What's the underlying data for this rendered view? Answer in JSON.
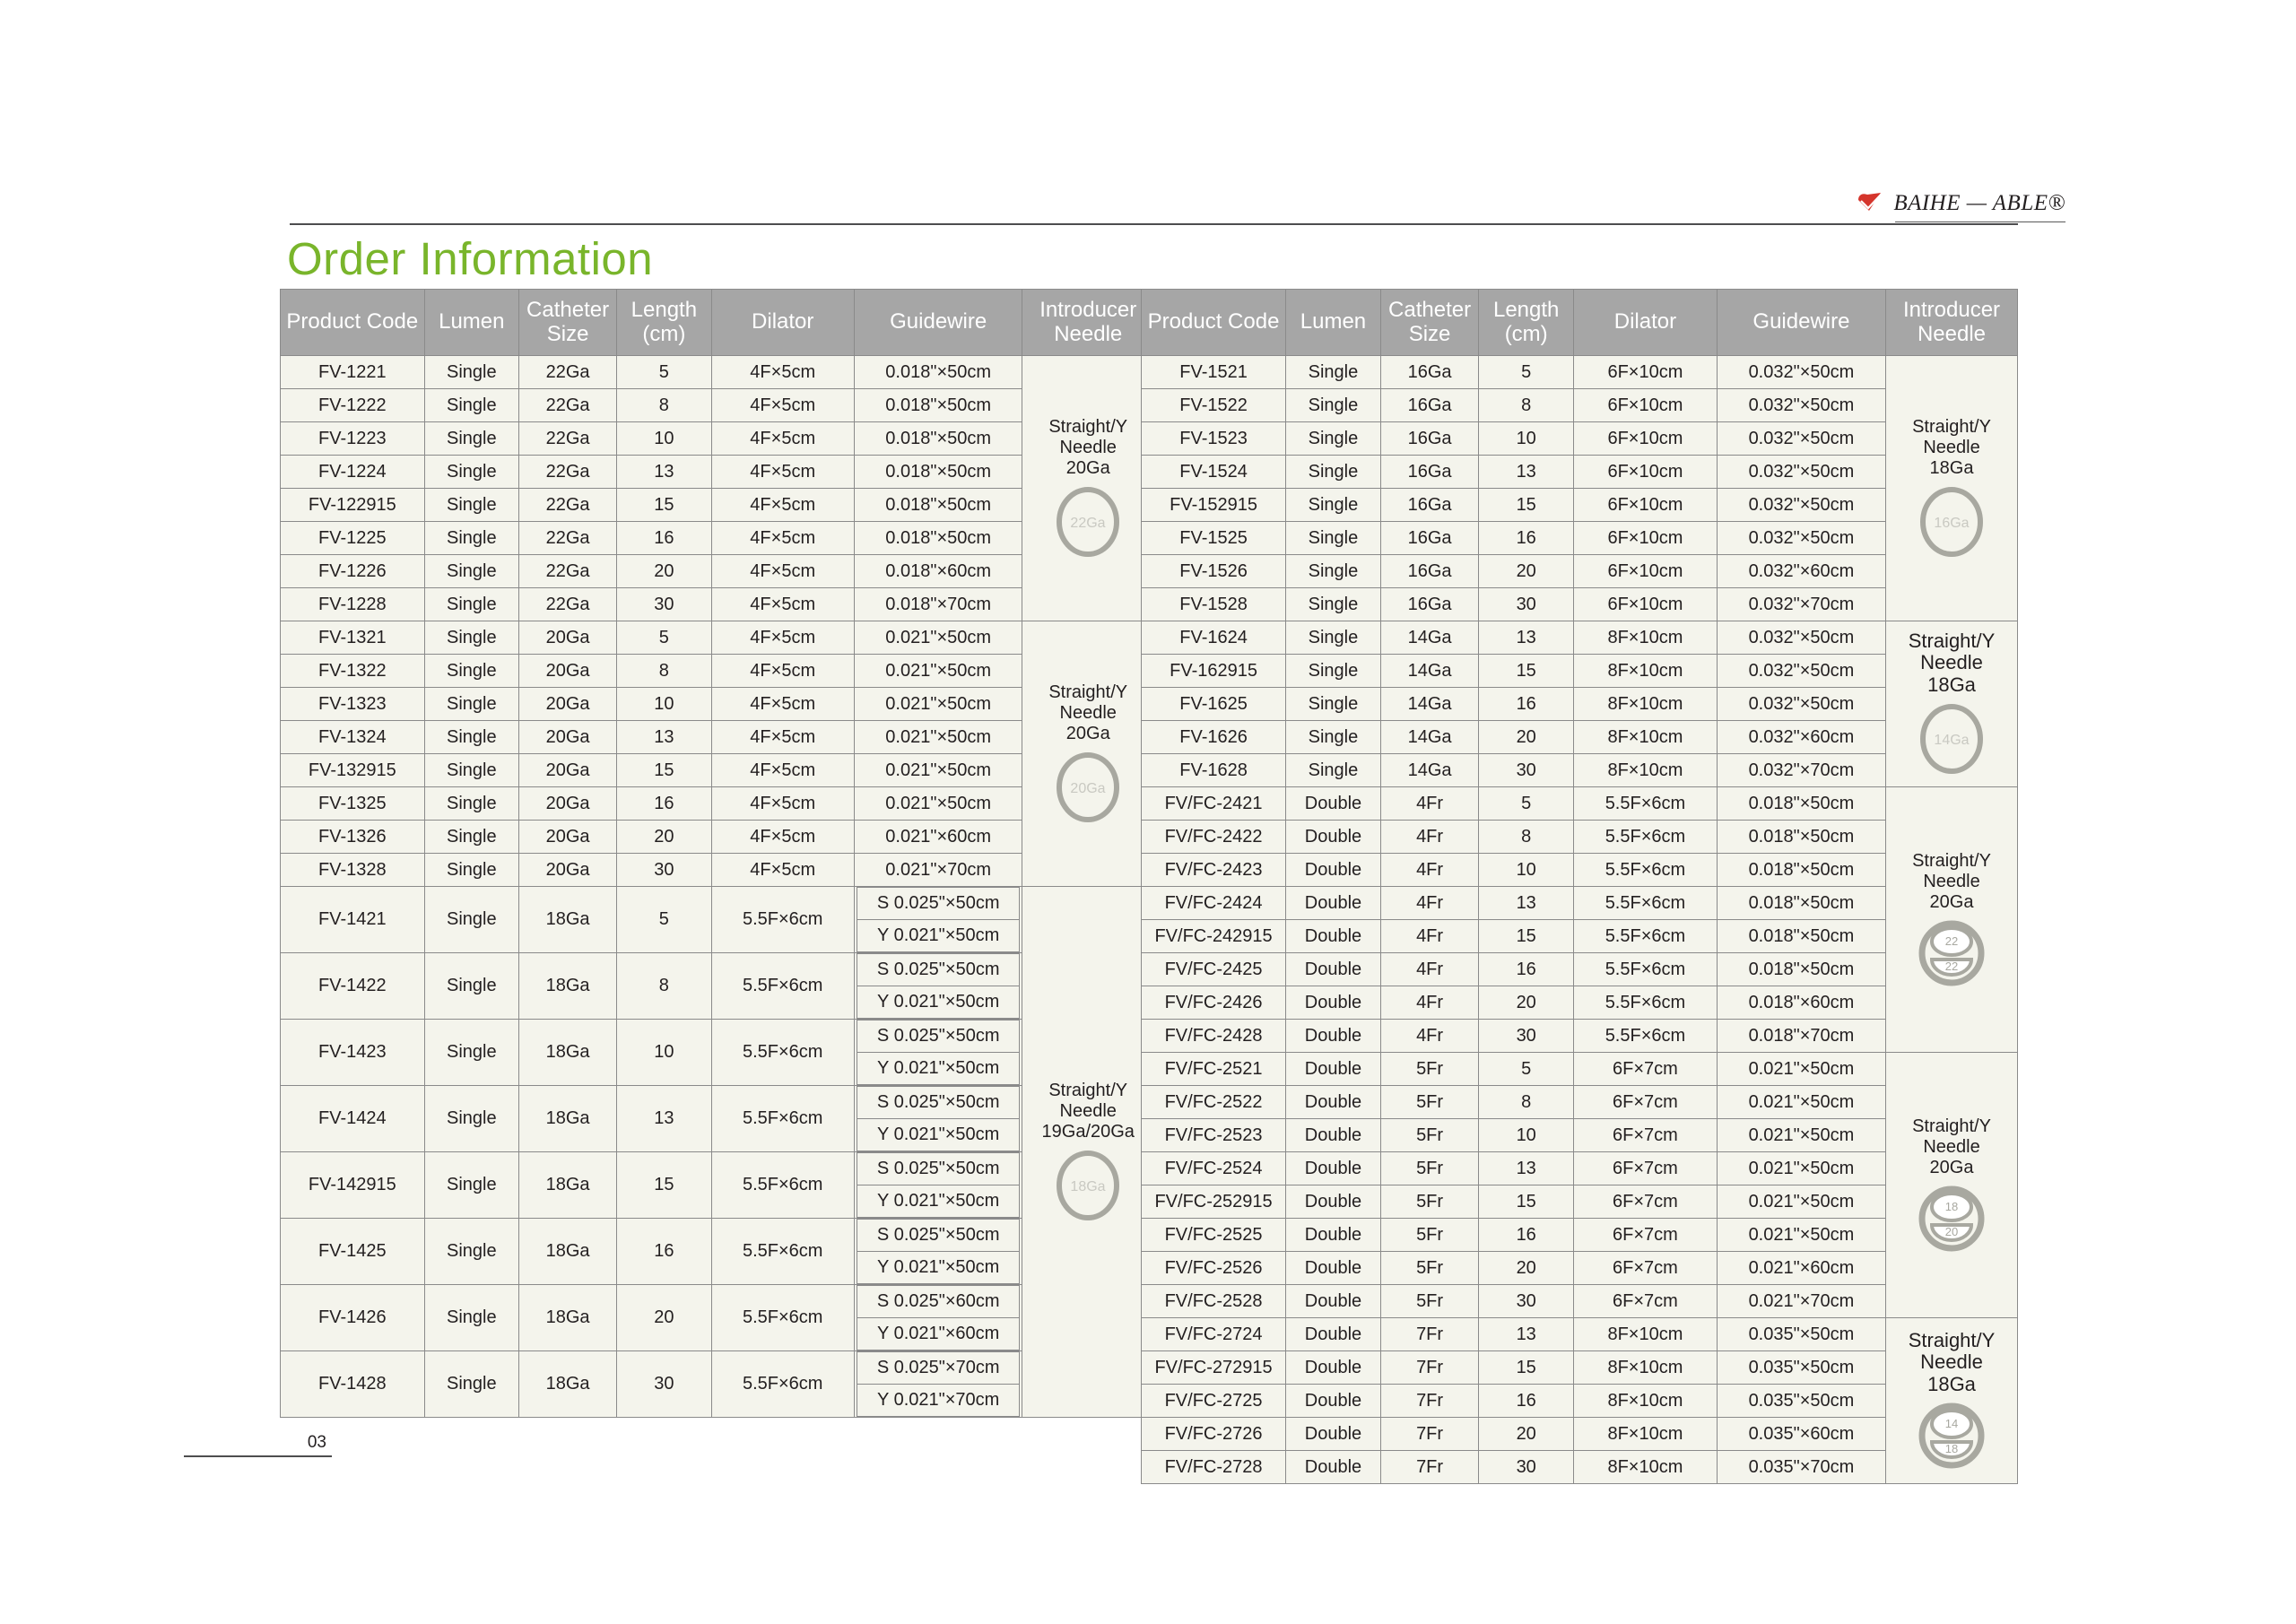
{
  "brand": {
    "name": "BAIHE — ABLE®",
    "check_color": "#d5352c"
  },
  "page_title": "Order Information",
  "folio": "03",
  "accent_color": "#79b52b",
  "header_bg": "#a6a6a6",
  "columns": [
    "Product Code",
    "Lumen",
    "Catheter Size",
    "Length (cm)",
    "Dilator",
    "Guidewire",
    "Introducer Needle"
  ],
  "left_table": {
    "groups": [
      {
        "needle": "Straight/Y Needle 20Ga",
        "needle_lines": [
          "Straight/Y",
          "Needle",
          "20Ga"
        ],
        "icon": {
          "type": "single-circle",
          "labels": [
            "22Ga"
          ]
        },
        "rows": [
          {
            "code": "FV-1221",
            "lumen": "Single",
            "catheter": "22Ga",
            "length": "5",
            "dilator": "4F×5cm",
            "guidewire": [
              "0.018\"×50cm"
            ]
          },
          {
            "code": "FV-1222",
            "lumen": "Single",
            "catheter": "22Ga",
            "length": "8",
            "dilator": "4F×5cm",
            "guidewire": [
              "0.018\"×50cm"
            ]
          },
          {
            "code": "FV-1223",
            "lumen": "Single",
            "catheter": "22Ga",
            "length": "10",
            "dilator": "4F×5cm",
            "guidewire": [
              "0.018\"×50cm"
            ]
          },
          {
            "code": "FV-1224",
            "lumen": "Single",
            "catheter": "22Ga",
            "length": "13",
            "dilator": "4F×5cm",
            "guidewire": [
              "0.018\"×50cm"
            ]
          },
          {
            "code": "FV-122915",
            "lumen": "Single",
            "catheter": "22Ga",
            "length": "15",
            "dilator": "4F×5cm",
            "guidewire": [
              "0.018\"×50cm"
            ]
          },
          {
            "code": "FV-1225",
            "lumen": "Single",
            "catheter": "22Ga",
            "length": "16",
            "dilator": "4F×5cm",
            "guidewire": [
              "0.018\"×50cm"
            ]
          },
          {
            "code": "FV-1226",
            "lumen": "Single",
            "catheter": "22Ga",
            "length": "20",
            "dilator": "4F×5cm",
            "guidewire": [
              "0.018\"×60cm"
            ]
          },
          {
            "code": "FV-1228",
            "lumen": "Single",
            "catheter": "22Ga",
            "length": "30",
            "dilator": "4F×5cm",
            "guidewire": [
              "0.018\"×70cm"
            ]
          }
        ]
      },
      {
        "needle": "Straight/Y Needle 20Ga",
        "needle_lines": [
          "Straight/Y",
          "Needle",
          "20Ga"
        ],
        "icon": {
          "type": "single-circle",
          "labels": [
            "20Ga"
          ]
        },
        "rows": [
          {
            "code": "FV-1321",
            "lumen": "Single",
            "catheter": "20Ga",
            "length": "5",
            "dilator": "4F×5cm",
            "guidewire": [
              "0.021\"×50cm"
            ]
          },
          {
            "code": "FV-1322",
            "lumen": "Single",
            "catheter": "20Ga",
            "length": "8",
            "dilator": "4F×5cm",
            "guidewire": [
              "0.021\"×50cm"
            ]
          },
          {
            "code": "FV-1323",
            "lumen": "Single",
            "catheter": "20Ga",
            "length": "10",
            "dilator": "4F×5cm",
            "guidewire": [
              "0.021\"×50cm"
            ]
          },
          {
            "code": "FV-1324",
            "lumen": "Single",
            "catheter": "20Ga",
            "length": "13",
            "dilator": "4F×5cm",
            "guidewire": [
              "0.021\"×50cm"
            ]
          },
          {
            "code": "FV-132915",
            "lumen": "Single",
            "catheter": "20Ga",
            "length": "15",
            "dilator": "4F×5cm",
            "guidewire": [
              "0.021\"×50cm"
            ]
          },
          {
            "code": "FV-1325",
            "lumen": "Single",
            "catheter": "20Ga",
            "length": "16",
            "dilator": "4F×5cm",
            "guidewire": [
              "0.021\"×50cm"
            ]
          },
          {
            "code": "FV-1326",
            "lumen": "Single",
            "catheter": "20Ga",
            "length": "20",
            "dilator": "4F×5cm",
            "guidewire": [
              "0.021\"×60cm"
            ]
          },
          {
            "code": "FV-1328",
            "lumen": "Single",
            "catheter": "20Ga",
            "length": "30",
            "dilator": "4F×5cm",
            "guidewire": [
              "0.021\"×70cm"
            ]
          }
        ]
      },
      {
        "needle": "Straight/Y Needle 19Ga/20Ga",
        "needle_lines": [
          "Straight/Y",
          "Needle",
          "19Ga/20Ga"
        ],
        "icon": {
          "type": "single-circle",
          "labels": [
            "18Ga"
          ]
        },
        "rows": [
          {
            "code": "FV-1421",
            "lumen": "Single",
            "catheter": "18Ga",
            "length": "5",
            "dilator": "5.5F×6cm",
            "guidewire": [
              "S 0.025\"×50cm",
              "Y 0.021\"×50cm"
            ]
          },
          {
            "code": "FV-1422",
            "lumen": "Single",
            "catheter": "18Ga",
            "length": "8",
            "dilator": "5.5F×6cm",
            "guidewire": [
              "S 0.025\"×50cm",
              "Y 0.021\"×50cm"
            ]
          },
          {
            "code": "FV-1423",
            "lumen": "Single",
            "catheter": "18Ga",
            "length": "10",
            "dilator": "5.5F×6cm",
            "guidewire": [
              "S 0.025\"×50cm",
              "Y 0.021\"×50cm"
            ]
          },
          {
            "code": "FV-1424",
            "lumen": "Single",
            "catheter": "18Ga",
            "length": "13",
            "dilator": "5.5F×6cm",
            "guidewire": [
              "S 0.025\"×50cm",
              "Y 0.021\"×50cm"
            ]
          },
          {
            "code": "FV-142915",
            "lumen": "Single",
            "catheter": "18Ga",
            "length": "15",
            "dilator": "5.5F×6cm",
            "guidewire": [
              "S 0.025\"×50cm",
              "Y 0.021\"×50cm"
            ]
          },
          {
            "code": "FV-1425",
            "lumen": "Single",
            "catheter": "18Ga",
            "length": "16",
            "dilator": "5.5F×6cm",
            "guidewire": [
              "S 0.025\"×50cm",
              "Y 0.021\"×50cm"
            ]
          },
          {
            "code": "FV-1426",
            "lumen": "Single",
            "catheter": "18Ga",
            "length": "20",
            "dilator": "5.5F×6cm",
            "guidewire": [
              "S 0.025\"×60cm",
              "Y 0.021\"×60cm"
            ]
          },
          {
            "code": "FV-1428",
            "lumen": "Single",
            "catheter": "18Ga",
            "length": "30",
            "dilator": "5.5F×6cm",
            "guidewire": [
              "S 0.025\"×70cm",
              "Y 0.021\"×70cm"
            ]
          }
        ]
      }
    ]
  },
  "right_table": {
    "groups": [
      {
        "needle": "Straight/Y Needle 18Ga",
        "needle_lines": [
          "Straight/Y",
          "Needle",
          "18Ga"
        ],
        "icon": {
          "type": "single-circle",
          "labels": [
            "16Ga"
          ]
        },
        "rows": [
          {
            "code": "FV-1521",
            "lumen": "Single",
            "catheter": "16Ga",
            "length": "5",
            "dilator": "6F×10cm",
            "guidewire": [
              "0.032\"×50cm"
            ]
          },
          {
            "code": "FV-1522",
            "lumen": "Single",
            "catheter": "16Ga",
            "length": "8",
            "dilator": "6F×10cm",
            "guidewire": [
              "0.032\"×50cm"
            ]
          },
          {
            "code": "FV-1523",
            "lumen": "Single",
            "catheter": "16Ga",
            "length": "10",
            "dilator": "6F×10cm",
            "guidewire": [
              "0.032\"×50cm"
            ]
          },
          {
            "code": "FV-1524",
            "lumen": "Single",
            "catheter": "16Ga",
            "length": "13",
            "dilator": "6F×10cm",
            "guidewire": [
              "0.032\"×50cm"
            ]
          },
          {
            "code": "FV-152915",
            "lumen": "Single",
            "catheter": "16Ga",
            "length": "15",
            "dilator": "6F×10cm",
            "guidewire": [
              "0.032\"×50cm"
            ]
          },
          {
            "code": "FV-1525",
            "lumen": "Single",
            "catheter": "16Ga",
            "length": "16",
            "dilator": "6F×10cm",
            "guidewire": [
              "0.032\"×50cm"
            ]
          },
          {
            "code": "FV-1526",
            "lumen": "Single",
            "catheter": "16Ga",
            "length": "20",
            "dilator": "6F×10cm",
            "guidewire": [
              "0.032\"×60cm"
            ]
          },
          {
            "code": "FV-1528",
            "lumen": "Single",
            "catheter": "16Ga",
            "length": "30",
            "dilator": "6F×10cm",
            "guidewire": [
              "0.032\"×70cm"
            ]
          }
        ]
      },
      {
        "needle": "Straight/Y Needle 18Ga",
        "needle_lines": [
          "Straight/Y",
          "Needle",
          "18Ga"
        ],
        "icon": {
          "type": "single-circle",
          "labels": [
            "14Ga"
          ]
        },
        "rows": [
          {
            "code": "FV-1624",
            "lumen": "Single",
            "catheter": "14Ga",
            "length": "13",
            "dilator": "8F×10cm",
            "guidewire": [
              "0.032\"×50cm"
            ]
          },
          {
            "code": "FV-162915",
            "lumen": "Single",
            "catheter": "14Ga",
            "length": "15",
            "dilator": "8F×10cm",
            "guidewire": [
              "0.032\"×50cm"
            ]
          },
          {
            "code": "FV-1625",
            "lumen": "Single",
            "catheter": "14Ga",
            "length": "16",
            "dilator": "8F×10cm",
            "guidewire": [
              "0.032\"×50cm"
            ]
          },
          {
            "code": "FV-1626",
            "lumen": "Single",
            "catheter": "14Ga",
            "length": "20",
            "dilator": "8F×10cm",
            "guidewire": [
              "0.032\"×60cm"
            ]
          },
          {
            "code": "FV-1628",
            "lumen": "Single",
            "catheter": "14Ga",
            "length": "30",
            "dilator": "8F×10cm",
            "guidewire": [
              "0.032\"×70cm"
            ]
          }
        ]
      },
      {
        "needle": "Straight/Y Needle 20Ga",
        "needle_lines": [
          "Straight/Y",
          "Needle",
          "20Ga"
        ],
        "icon": {
          "type": "double-circle",
          "labels": [
            "22",
            "22"
          ]
        },
        "rows": [
          {
            "code": "FV/FC-2421",
            "lumen": "Double",
            "catheter": "4Fr",
            "length": "5",
            "dilator": "5.5F×6cm",
            "guidewire": [
              "0.018\"×50cm"
            ]
          },
          {
            "code": "FV/FC-2422",
            "lumen": "Double",
            "catheter": "4Fr",
            "length": "8",
            "dilator": "5.5F×6cm",
            "guidewire": [
              "0.018\"×50cm"
            ]
          },
          {
            "code": "FV/FC-2423",
            "lumen": "Double",
            "catheter": "4Fr",
            "length": "10",
            "dilator": "5.5F×6cm",
            "guidewire": [
              "0.018\"×50cm"
            ]
          },
          {
            "code": "FV/FC-2424",
            "lumen": "Double",
            "catheter": "4Fr",
            "length": "13",
            "dilator": "5.5F×6cm",
            "guidewire": [
              "0.018\"×50cm"
            ]
          },
          {
            "code": "FV/FC-242915",
            "lumen": "Double",
            "catheter": "4Fr",
            "length": "15",
            "dilator": "5.5F×6cm",
            "guidewire": [
              "0.018\"×50cm"
            ]
          },
          {
            "code": "FV/FC-2425",
            "lumen": "Double",
            "catheter": "4Fr",
            "length": "16",
            "dilator": "5.5F×6cm",
            "guidewire": [
              "0.018\"×50cm"
            ]
          },
          {
            "code": "FV/FC-2426",
            "lumen": "Double",
            "catheter": "4Fr",
            "length": "20",
            "dilator": "5.5F×6cm",
            "guidewire": [
              "0.018\"×60cm"
            ]
          },
          {
            "code": "FV/FC-2428",
            "lumen": "Double",
            "catheter": "4Fr",
            "length": "30",
            "dilator": "5.5F×6cm",
            "guidewire": [
              "0.018\"×70cm"
            ]
          }
        ]
      },
      {
        "needle": "Straight/Y Needle 20Ga",
        "needle_lines": [
          "Straight/Y",
          "Needle",
          "20Ga"
        ],
        "icon": {
          "type": "double-circle",
          "labels": [
            "18",
            "20"
          ]
        },
        "rows": [
          {
            "code": "FV/FC-2521",
            "lumen": "Double",
            "catheter": "5Fr",
            "length": "5",
            "dilator": "6F×7cm",
            "guidewire": [
              "0.021\"×50cm"
            ]
          },
          {
            "code": "FV/FC-2522",
            "lumen": "Double",
            "catheter": "5Fr",
            "length": "8",
            "dilator": "6F×7cm",
            "guidewire": [
              "0.021\"×50cm"
            ]
          },
          {
            "code": "FV/FC-2523",
            "lumen": "Double",
            "catheter": "5Fr",
            "length": "10",
            "dilator": "6F×7cm",
            "guidewire": [
              "0.021\"×50cm"
            ]
          },
          {
            "code": "FV/FC-2524",
            "lumen": "Double",
            "catheter": "5Fr",
            "length": "13",
            "dilator": "6F×7cm",
            "guidewire": [
              "0.021\"×50cm"
            ]
          },
          {
            "code": "FV/FC-252915",
            "lumen": "Double",
            "catheter": "5Fr",
            "length": "15",
            "dilator": "6F×7cm",
            "guidewire": [
              "0.021\"×50cm"
            ]
          },
          {
            "code": "FV/FC-2525",
            "lumen": "Double",
            "catheter": "5Fr",
            "length": "16",
            "dilator": "6F×7cm",
            "guidewire": [
              "0.021\"×50cm"
            ]
          },
          {
            "code": "FV/FC-2526",
            "lumen": "Double",
            "catheter": "5Fr",
            "length": "20",
            "dilator": "6F×7cm",
            "guidewire": [
              "0.021\"×60cm"
            ]
          },
          {
            "code": "FV/FC-2528",
            "lumen": "Double",
            "catheter": "5Fr",
            "length": "30",
            "dilator": "6F×7cm",
            "guidewire": [
              "0.021\"×70cm"
            ]
          }
        ]
      },
      {
        "needle": "Straight/Y Needle 18Ga",
        "needle_lines": [
          "Straight/Y",
          "Needle",
          "18Ga"
        ],
        "icon": {
          "type": "double-circle",
          "labels": [
            "14",
            "18"
          ]
        },
        "rows": [
          {
            "code": "FV/FC-2724",
            "lumen": "Double",
            "catheter": "7Fr",
            "length": "13",
            "dilator": "8F×10cm",
            "guidewire": [
              "0.035\"×50cm"
            ]
          },
          {
            "code": "FV/FC-272915",
            "lumen": "Double",
            "catheter": "7Fr",
            "length": "15",
            "dilator": "8F×10cm",
            "guidewire": [
              "0.035\"×50cm"
            ]
          },
          {
            "code": "FV/FC-2725",
            "lumen": "Double",
            "catheter": "7Fr",
            "length": "16",
            "dilator": "8F×10cm",
            "guidewire": [
              "0.035\"×50cm"
            ]
          },
          {
            "code": "FV/FC-2726",
            "lumen": "Double",
            "catheter": "7Fr",
            "length": "20",
            "dilator": "8F×10cm",
            "guidewire": [
              "0.035\"×60cm"
            ]
          },
          {
            "code": "FV/FC-2728",
            "lumen": "Double",
            "catheter": "7Fr",
            "length": "30",
            "dilator": "8F×10cm",
            "guidewire": [
              "0.035\"×70cm"
            ]
          }
        ]
      }
    ]
  }
}
